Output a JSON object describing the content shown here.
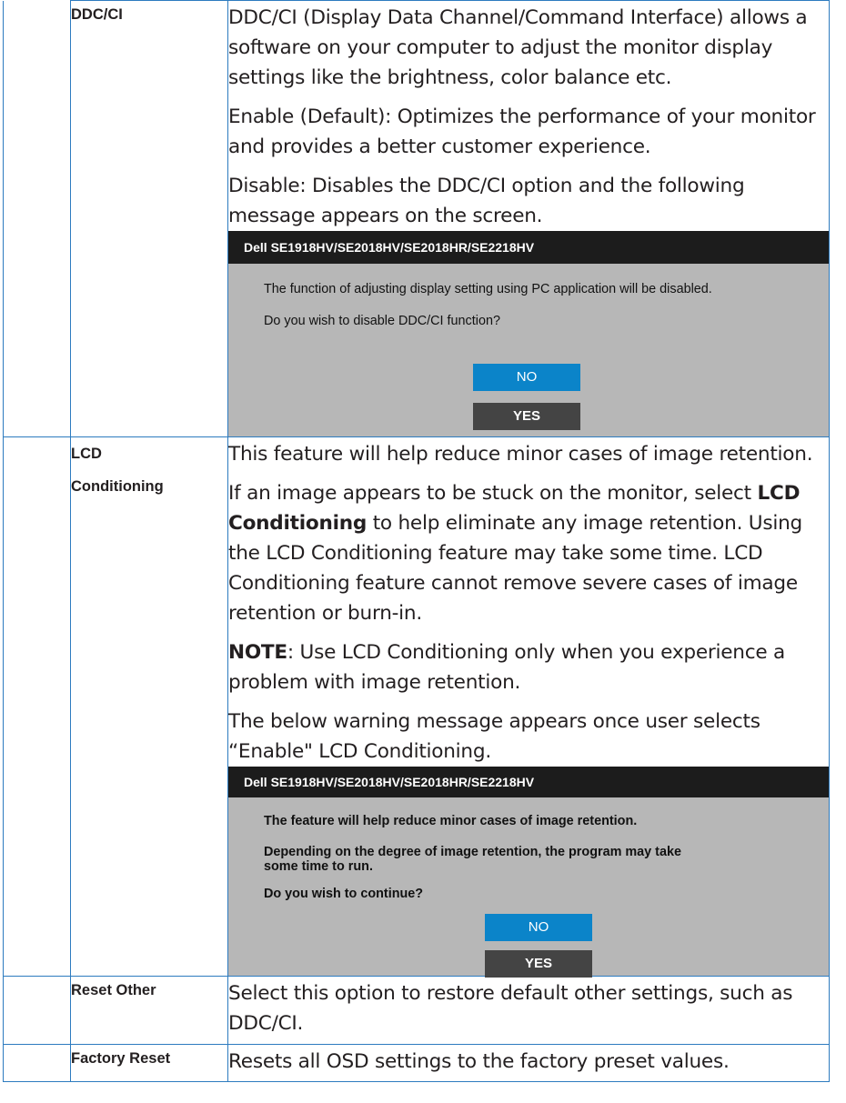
{
  "rows": [
    {
      "label": "DDC/CI",
      "paragraphs": [
        "DDC/CI (Display Data Channel/Command Interface) allows a software on your computer to adjust the monitor display settings like the brightness, color balance etc.",
        "Enable (Default): Optimizes the performance of your monitor and provides a better customer experience.",
        "Disable: Disables the DDC/CI option and the following message appears on the screen."
      ],
      "dialog": {
        "title": "Dell SE1918HV/SE2018HV/SE2018HR/SE2218HV",
        "line1": "The function of adjusting display setting using PC application will be disabled.",
        "line2": "Do you wish to disable DDC/CI function?",
        "no": "NO",
        "yes": "YES"
      }
    },
    {
      "label": "LCD Conditioning",
      "p1": "This feature will help reduce minor cases of image retention.",
      "p2_before": "If an image appears to be stuck on the monitor, select ",
      "p2_bold": "LCD Conditioning",
      "p2_after": " to help eliminate any image retention. Using the LCD Conditioning feature may take some time. LCD Conditioning feature cannot remove  severe cases of image retention or burn-in.",
      "note_bold": "NOTE",
      "note_text": ": Use LCD Conditioning only when you experience a problem with image retention.",
      "p4": "The below warning message appears once user selects “Enable\" LCD Conditioning.",
      "dialog": {
        "title": "Dell SE1918HV/SE2018HV/SE2018HR/SE2218HV",
        "line1": "The feature will help reduce minor cases of image retention.",
        "line2a": "Depending on the degree of image retention, the program may take",
        "line2b": "some time to run.",
        "line3": "Do you wish to continue?",
        "no": "NO",
        "yes": "YES"
      }
    },
    {
      "label": "Reset Other",
      "text": "Select this option to restore default other settings, such as DDC/CI."
    },
    {
      "label": "Factory Reset",
      "text": "Resets all OSD settings to the factory preset values."
    }
  ]
}
